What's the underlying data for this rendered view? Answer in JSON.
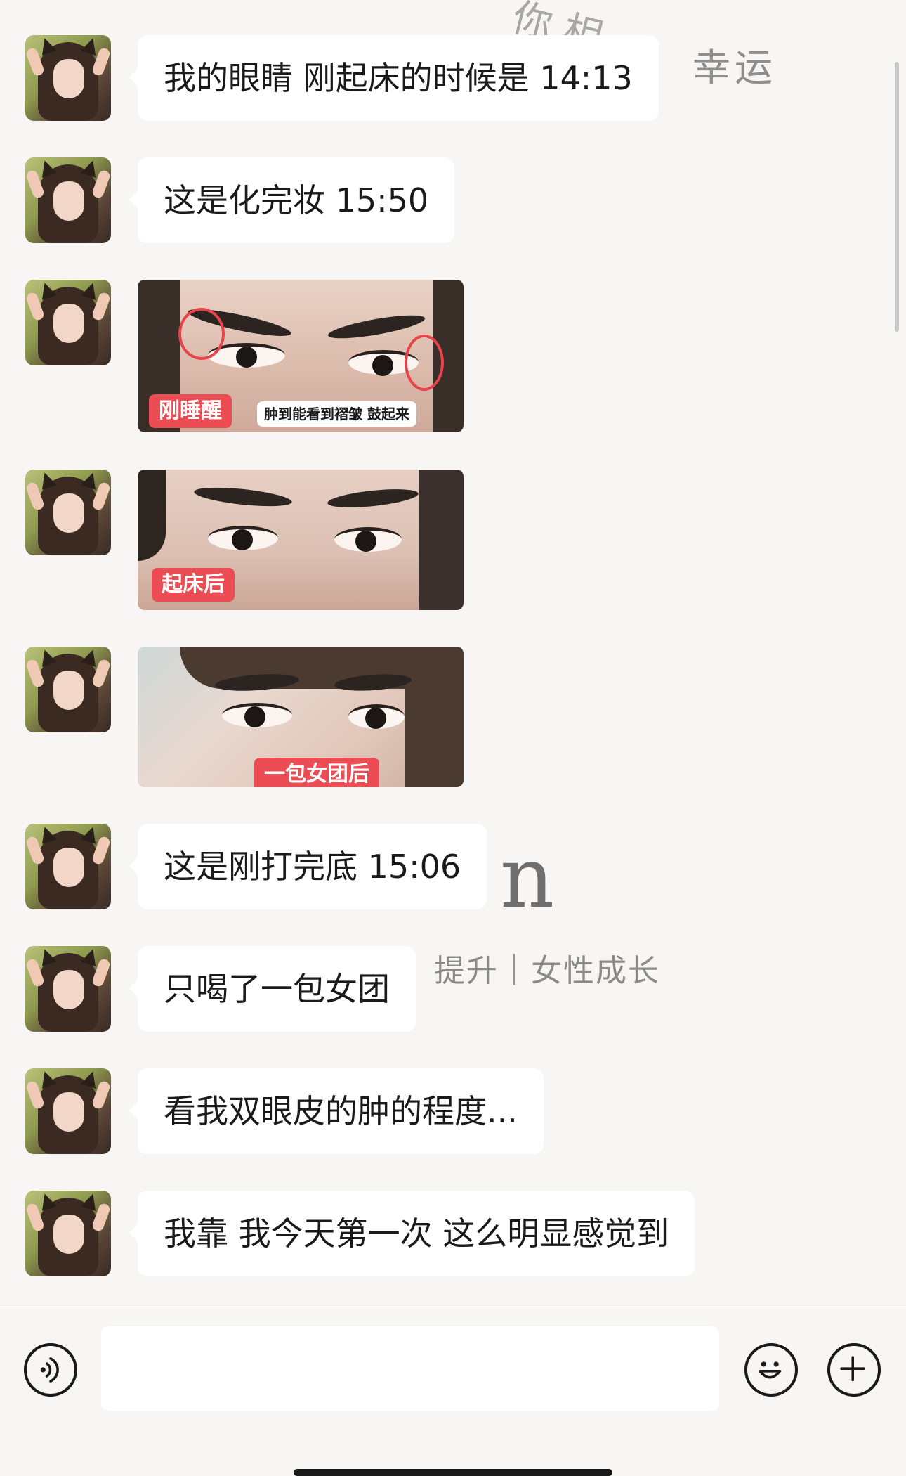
{
  "wallpaper": {
    "lucky_text": "幸运",
    "partial_text": "你 相",
    "large_letter": "n",
    "tagline": "提升｜女性成长"
  },
  "messages": [
    {
      "type": "text",
      "text": "我的眼睛 刚起床的时候是 14:13"
    },
    {
      "type": "text",
      "text": "这是化完妆 15:50"
    },
    {
      "type": "image",
      "tag": "刚睡醒",
      "note": "肿到能看到褶皱 鼓起来"
    },
    {
      "type": "image",
      "tag": "起床后"
    },
    {
      "type": "image",
      "tag": "一包女团后"
    },
    {
      "type": "text",
      "text": "这是刚打完底 15:06"
    },
    {
      "type": "text",
      "text": "只喝了一包女团"
    },
    {
      "type": "text",
      "text": "看我双眼皮的肿的程度..."
    },
    {
      "type": "text",
      "text": "我靠 我今天第一次 这么明显感觉到"
    }
  ],
  "input_bar": {
    "value": "",
    "icons": [
      "voice-icon",
      "emoji-icon",
      "plus-icon"
    ]
  }
}
